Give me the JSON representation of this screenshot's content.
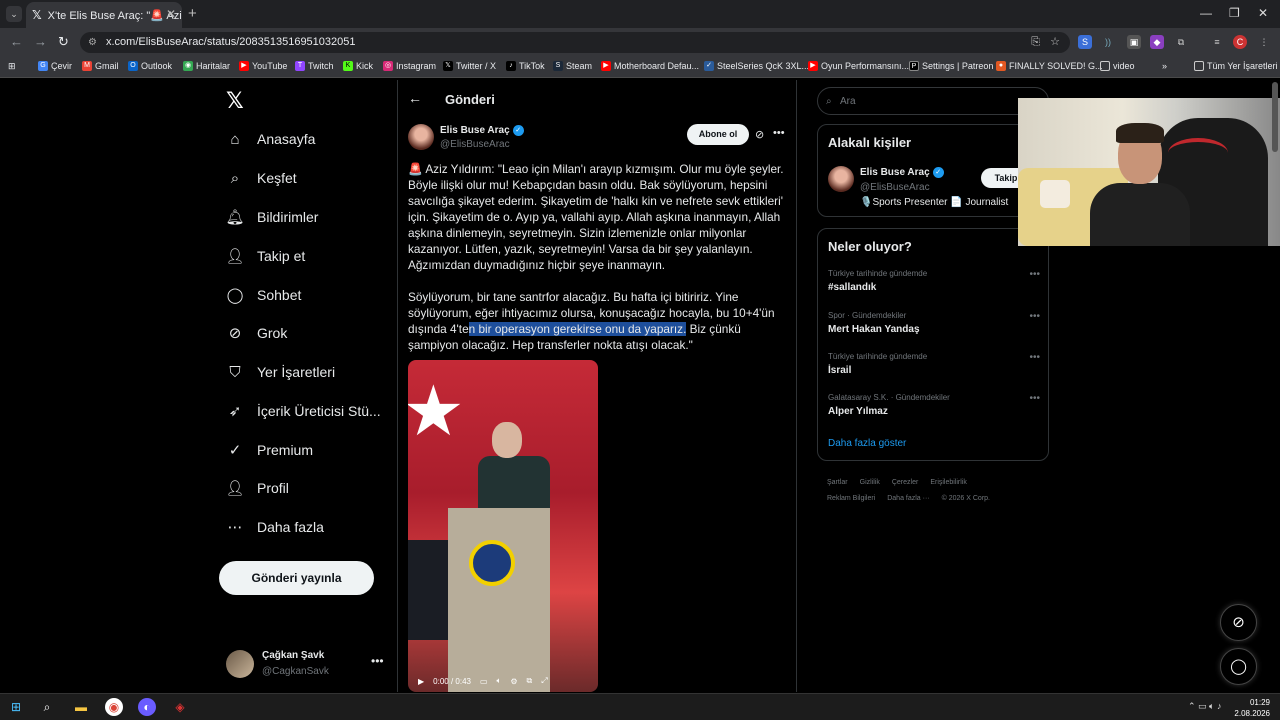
{
  "browser": {
    "tab_title": "X'te Elis Buse Araç: \"🚨 Aziz Yıld",
    "url": "x.com/ElisBuseArac/status/2083513516951032051",
    "bookmarks": [
      "Çevir",
      "Gmail",
      "Outlook",
      "Haritalar",
      "YouTube",
      "Twitch",
      "Kick",
      "Instagram",
      "Twitter / X",
      "TikTok",
      "Steam",
      "Motherboard Defau...",
      "SteelSeries QcK 3XL...",
      "Oyun Performansını...",
      "Settings | Patreon",
      "FINALLY SOLVED! G...",
      "video"
    ],
    "all_bookmarks": "Tüm Yer İşaretleri"
  },
  "nav": {
    "items": [
      "Anasayfa",
      "Keşfet",
      "Bildirimler",
      "Takip et",
      "Sohbet",
      "Grok",
      "Yer İşaretleri",
      "İçerik Üreticisi Stü...",
      "Premium",
      "Profil",
      "Daha fazla"
    ],
    "post_button": "Gönderi yayınla",
    "user_name": "Çağkan Şavk",
    "user_handle": "@CagkanSavk"
  },
  "post": {
    "header": "Gönderi",
    "author_name": "Elis Buse Araç",
    "author_handle": "@ElisBuseArac",
    "follow_label": "Abone ol",
    "paragraph1": "🚨 Aziz Yıldırım: \"Leao için Milan'ı arayıp kızmışım. Olur mu öyle şeyler. Böyle ilişki olur mu! Kebapçıdan basın oldu. Bak söylüyorum, hepsini savcılığa şikayet ederim. Şikayetim de 'halkı kin ve nefrete sevk ettikleri' için. Şikayetim de o. Ayıp ya, vallahi ayıp. Allah aşkına inanmayın, Allah aşkına dinlemeyin, seyretmeyin. Sizin izlemenizle onlar milyonlar kazanıyor. Lütfen, yazık, seyretmeyin! Varsa da bir şey yalanlayın. Ağzımızdan duymadığınız hiçbir şeye inanmayın.",
    "p2_before": "Söylüyorum, bir tane santrfor alacağız. Bu hafta içi bitiririz. Yine söylüyorum, eğer ihtiyacımız olursa, konuşacağız hocayla, bu 10+4'ün dışında 4'te",
    "p2_highlight": "n bir operasyon gerekirse onu da yaparız.",
    "p2_after": " Biz çünkü şampiyon olacağız. Hep transferler nokta atışı olacak.\"",
    "video_time": "0:00 / 0:43"
  },
  "sidebar": {
    "search_placeholder": "Ara",
    "related_title": "Alakalı kişiler",
    "related_name": "Elis Buse Araç",
    "related_handle": "@ElisBuseArac",
    "related_bio": "🎙️Sports Presenter 📄 Journalist",
    "related_follow": "Takip",
    "trends_title": "Neler oluyor?",
    "trends": [
      {
        "context": "Türkiye tarihinde gündemde",
        "name": "#sallandık"
      },
      {
        "context": "Spor · Gündemdekiler",
        "name": "Mert Hakan Yandaş"
      },
      {
        "context": "Türkiye tarihinde gündemde",
        "name": "İsrail"
      },
      {
        "context": "Galatasaray S.K. · Gündemdekiler",
        "name": "Alper Yılmaz"
      }
    ],
    "show_more": "Daha fazla göster",
    "footer": [
      "Şartlar",
      "Gizlilik",
      "Çerezler",
      "Erişilebilirlik",
      "Reklam Bilgileri",
      "Daha fazla ···",
      "© 2026 X Corp."
    ]
  },
  "taskbar": {
    "time": "01:29",
    "date": "2.08.2026"
  }
}
